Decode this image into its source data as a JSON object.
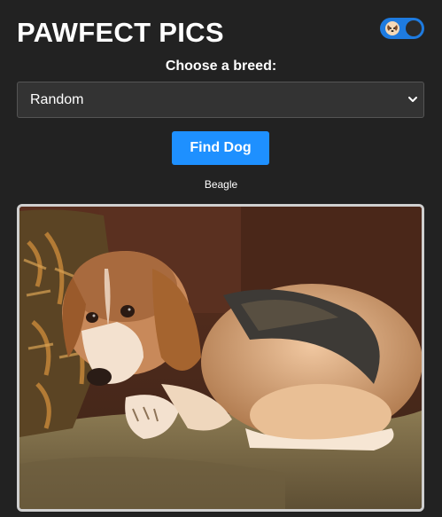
{
  "header": {
    "title": "PAWFECT PICS",
    "theme_toggle_icon": "moon-dog-icon"
  },
  "form": {
    "breed_label": "Choose a breed:",
    "breed_selected": "Random",
    "breed_options": [
      "Random"
    ],
    "find_button_label": "Find Dog"
  },
  "result": {
    "breed_name": "Beagle",
    "image_subject": "beagle-on-couch-photo"
  },
  "colors": {
    "background": "#222222",
    "accent": "#1e90ff",
    "toggle": "#1e7be0"
  }
}
